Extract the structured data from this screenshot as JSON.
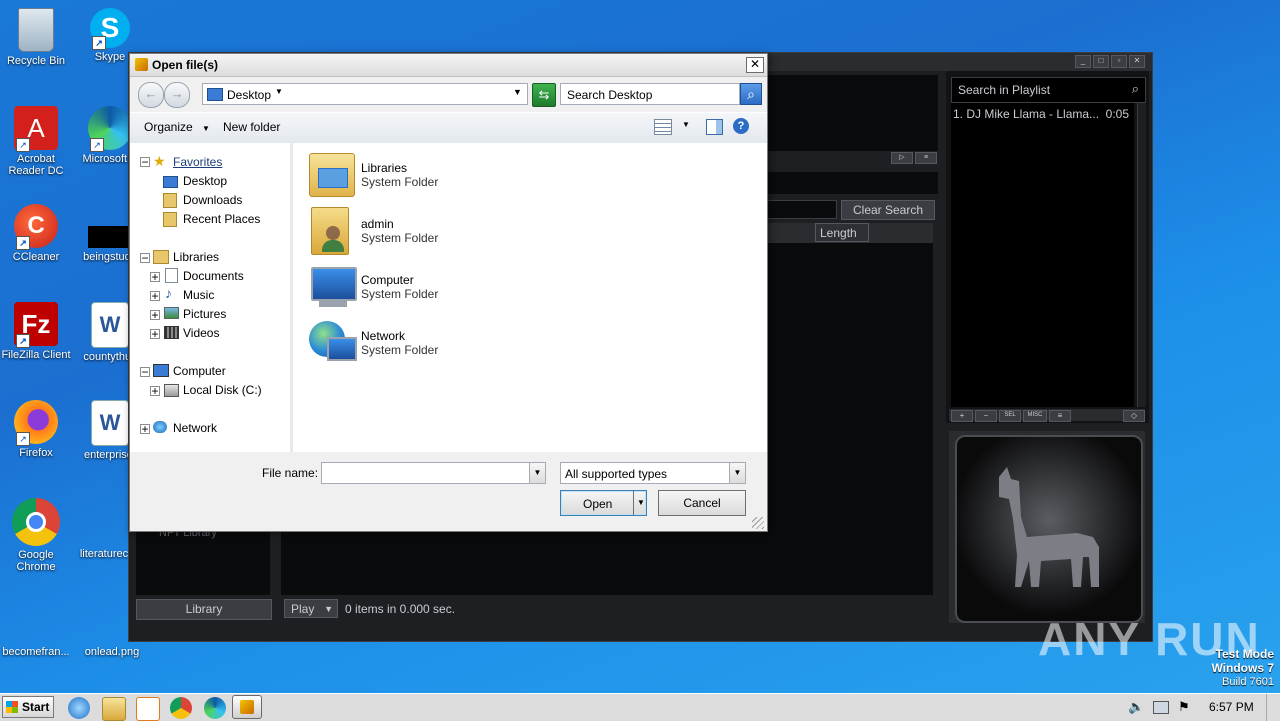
{
  "desktop": {
    "icons": [
      {
        "label": "Recycle Bin"
      },
      {
        "label": "Skype"
      },
      {
        "label": "Acrobat Reader DC"
      },
      {
        "label": "Microsoft E"
      },
      {
        "label": "CCleaner"
      },
      {
        "label": "beingstude"
      },
      {
        "label": "FileZilla Client"
      },
      {
        "label": "countythus"
      },
      {
        "label": "Firefox"
      },
      {
        "label": "enterprise."
      },
      {
        "label": "Google Chrome"
      },
      {
        "label": "literaturec"
      },
      {
        "label": "becomefran..."
      },
      {
        "label": "onlead.png"
      }
    ],
    "watermark": "ANY RUN",
    "testmode": {
      "line1": "Test Mode",
      "line2": "Windows 7",
      "line3": "Build 7601"
    }
  },
  "winamp": {
    "playlist_search_placeholder": "Search in Playlist",
    "playlist_item": "1. DJ Mike Llama - Llama...",
    "playlist_item_time": "0:05",
    "clear_search": "Clear Search",
    "length_header": "Length",
    "library_button": "Library",
    "play_button": "Play",
    "status": "0 items in 0.000 sec.",
    "nav_partial": "NFT Library",
    "plbar": {
      "add": "+",
      "rem": "−",
      "sel": "SEL",
      "misc": "MISC",
      "list": "≡"
    }
  },
  "dialog": {
    "title": "Open file(s)",
    "close": "✕",
    "location": "Desktop",
    "search_placeholder": "Search Desktop",
    "organize": "Organize",
    "new_folder": "New folder",
    "tree": {
      "favorites": "Favorites",
      "desktop": "Desktop",
      "downloads": "Downloads",
      "recent": "Recent Places",
      "libraries": "Libraries",
      "documents": "Documents",
      "music": "Music",
      "pictures": "Pictures",
      "videos": "Videos",
      "computer": "Computer",
      "local_disk": "Local Disk (C:)",
      "network": "Network"
    },
    "items": [
      {
        "name": "Libraries",
        "type": "System Folder"
      },
      {
        "name": "admin",
        "type": "System Folder"
      },
      {
        "name": "Computer",
        "type": "System Folder"
      },
      {
        "name": "Network",
        "type": "System Folder"
      }
    ],
    "file_name_label": "File name:",
    "file_name_value": "",
    "file_type": "All supported types",
    "open": "Open",
    "cancel": "Cancel"
  },
  "taskbar": {
    "start": "Start",
    "clock": "6:57 PM"
  }
}
